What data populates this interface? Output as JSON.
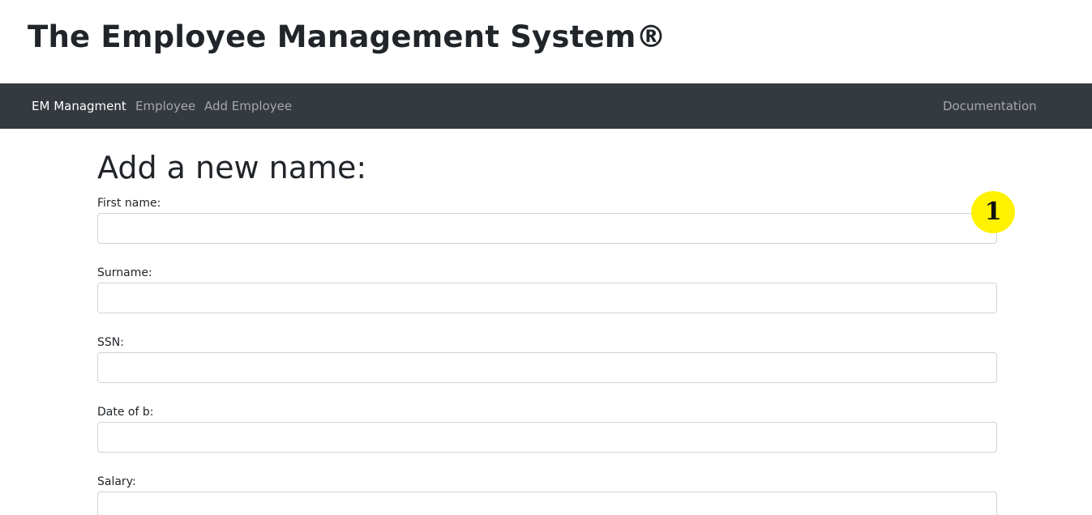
{
  "header": {
    "title": "The Employee Management System®"
  },
  "navbar": {
    "brand": "EM Managment",
    "links": [
      "Employee",
      "Add Employee"
    ],
    "right_link": "Documentation"
  },
  "form": {
    "heading": "Add a new name:",
    "fields": [
      {
        "label": "First name:",
        "value": ""
      },
      {
        "label": "Surname:",
        "value": ""
      },
      {
        "label": "SSN:",
        "value": ""
      },
      {
        "label": "Date of b:",
        "value": ""
      },
      {
        "label": "Salary:",
        "value": ""
      }
    ]
  },
  "annotation": {
    "step_number": "1",
    "color": "#fff200"
  }
}
